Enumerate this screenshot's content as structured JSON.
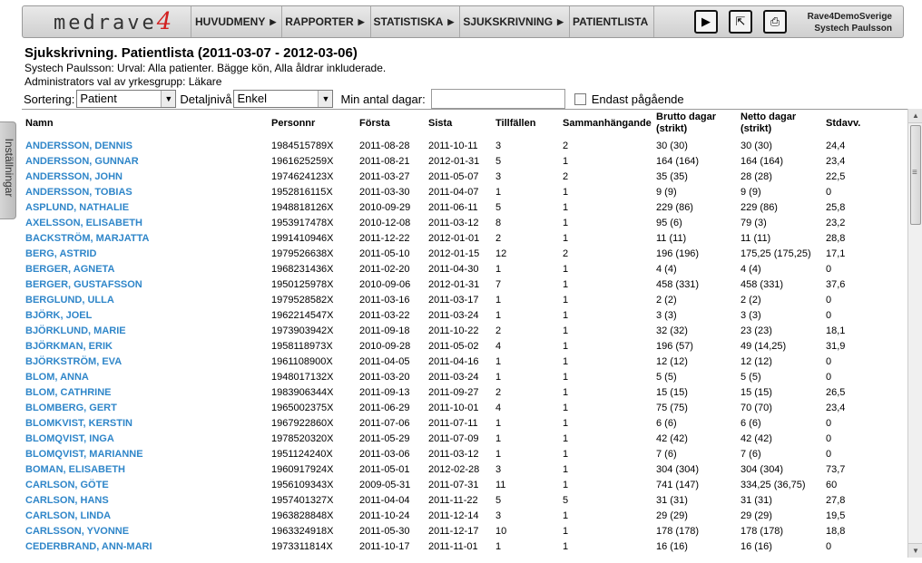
{
  "app": {
    "logo_text": "medrave",
    "logo_number": "4",
    "user_line1": "Rave4DemoSverige",
    "user_line2": "Systech Paulsson"
  },
  "nav": {
    "items": [
      {
        "label": "HUVUDMENY",
        "arrow": "▶"
      },
      {
        "label": "RAPPORTER",
        "arrow": "▶"
      },
      {
        "label": "STATISTISKA",
        "arrow": "▶"
      },
      {
        "label": "SJUKSKRIVNING",
        "arrow": "▶"
      },
      {
        "label": "PATIENTLISTA",
        "arrow": ""
      }
    ]
  },
  "toolbar": {
    "play_icon": "▶",
    "export_icon": "⇱",
    "print_icon": "⎙"
  },
  "side_tab": {
    "label": "Inställningar"
  },
  "page": {
    "title": "Sjukskrivning. Patientlista (2011-03-07 - 2012-03-06)",
    "subtitle": "Systech Paulsson: Urval: Alla patienter. Bägge kön, Alla åldrar inkluderade.",
    "subtitle2": "Administrators val av yrkesgrupp: Läkare"
  },
  "controls": {
    "sort_label": "Sortering:",
    "sort_value": "Patient",
    "detail_label": "Detaljnivå",
    "detail_value": "Enkel",
    "min_days_label": "Min antal dagar:",
    "min_days_value": "",
    "ongoing_label": "Endast pågående",
    "dropdown_glyph": "▼"
  },
  "table": {
    "headers": {
      "name": "Namn",
      "personnr": "Personnr",
      "forsta": "Första",
      "sista": "Sista",
      "tillfallen": "Tillfällen",
      "sammanhangande": "Sammanhängande",
      "brutto": "Brutto dagar\n(strikt)",
      "netto": "Netto dagar\n(strikt)",
      "stdavv": "Stdavv."
    },
    "rows": [
      [
        "ANDERSSON, DENNIS",
        "1984515789X",
        "2011-08-28",
        "2011-10-11",
        "3",
        "2",
        "30 (30)",
        "30 (30)",
        "24,4"
      ],
      [
        "ANDERSSON, GUNNAR",
        "1961625259X",
        "2011-08-21",
        "2012-01-31",
        "5",
        "1",
        "164 (164)",
        "164 (164)",
        "23,4"
      ],
      [
        "ANDERSSON, JOHN",
        "1974624123X",
        "2011-03-27",
        "2011-05-07",
        "3",
        "2",
        "35 (35)",
        "28 (28)",
        "22,5"
      ],
      [
        "ANDERSSON, TOBIAS",
        "1952816115X",
        "2011-03-30",
        "2011-04-07",
        "1",
        "1",
        "9 (9)",
        "9 (9)",
        "0"
      ],
      [
        "ASPLUND, NATHALIE",
        "1948818126X",
        "2010-09-29",
        "2011-06-11",
        "5",
        "1",
        "229 (86)",
        "229 (86)",
        "25,8"
      ],
      [
        "AXELSSON, ELISABETH",
        "1953917478X",
        "2010-12-08",
        "2011-03-12",
        "8",
        "1",
        "95 (6)",
        "79 (3)",
        "23,2"
      ],
      [
        "BACKSTRÖM, MARJATTA",
        "1991410946X",
        "2011-12-22",
        "2012-01-01",
        "2",
        "1",
        "11 (11)",
        "11 (11)",
        "28,8"
      ],
      [
        "BERG, ASTRID",
        "1979526638X",
        "2011-05-10",
        "2012-01-15",
        "12",
        "2",
        "196 (196)",
        "175,25 (175,25)",
        "17,1"
      ],
      [
        "BERGER, AGNETA",
        "1968231436X",
        "2011-02-20",
        "2011-04-30",
        "1",
        "1",
        "4 (4)",
        "4 (4)",
        "0"
      ],
      [
        "BERGER, GUSTAFSSON",
        "1950125978X",
        "2010-09-06",
        "2012-01-31",
        "7",
        "1",
        "458 (331)",
        "458 (331)",
        "37,6"
      ],
      [
        "BERGLUND, ULLA",
        "1979528582X",
        "2011-03-16",
        "2011-03-17",
        "1",
        "1",
        "2 (2)",
        "2 (2)",
        "0"
      ],
      [
        "BJÖRK, JOEL",
        "1962214547X",
        "2011-03-22",
        "2011-03-24",
        "1",
        "1",
        "3 (3)",
        "3 (3)",
        "0"
      ],
      [
        "BJÖRKLUND, MARIE",
        "1973903942X",
        "2011-09-18",
        "2011-10-22",
        "2",
        "1",
        "32 (32)",
        "23 (23)",
        "18,1"
      ],
      [
        "BJÖRKMAN, ERIK",
        "1958118973X",
        "2010-09-28",
        "2011-05-02",
        "4",
        "1",
        "196 (57)",
        "49 (14,25)",
        "31,9"
      ],
      [
        "BJÖRKSTRÖM, EVA",
        "1961108900X",
        "2011-04-05",
        "2011-04-16",
        "1",
        "1",
        "12 (12)",
        "12 (12)",
        "0"
      ],
      [
        "BLOM, ANNA",
        "1948017132X",
        "2011-03-20",
        "2011-03-24",
        "1",
        "1",
        "5 (5)",
        "5 (5)",
        "0"
      ],
      [
        "BLOM, CATHRINE",
        "1983906344X",
        "2011-09-13",
        "2011-09-27",
        "2",
        "1",
        "15 (15)",
        "15 (15)",
        "26,5"
      ],
      [
        "BLOMBERG, GERT",
        "1965002375X",
        "2011-06-29",
        "2011-10-01",
        "4",
        "1",
        "75 (75)",
        "70 (70)",
        "23,4"
      ],
      [
        "BLOMKVIST, KERSTIN",
        "1967922860X",
        "2011-07-06",
        "2011-07-11",
        "1",
        "1",
        "6 (6)",
        "6 (6)",
        "0"
      ],
      [
        "BLOMQVIST, INGA",
        "1978520320X",
        "2011-05-29",
        "2011-07-09",
        "1",
        "1",
        "42 (42)",
        "42 (42)",
        "0"
      ],
      [
        "BLOMQVIST, MARIANNE",
        "1951124240X",
        "2011-03-06",
        "2011-03-12",
        "1",
        "1",
        "7 (6)",
        "7 (6)",
        "0"
      ],
      [
        "BOMAN, ELISABETH",
        "1960917924X",
        "2011-05-01",
        "2012-02-28",
        "3",
        "1",
        "304 (304)",
        "304 (304)",
        "73,7"
      ],
      [
        "CARLSON, GÖTE",
        "1956109343X",
        "2009-05-31",
        "2011-07-31",
        "11",
        "1",
        "741 (147)",
        "334,25 (36,75)",
        "60"
      ],
      [
        "CARLSON, HANS",
        "1957401327X",
        "2011-04-04",
        "2011-11-22",
        "5",
        "5",
        "31 (31)",
        "31 (31)",
        "27,8"
      ],
      [
        "CARLSON, LINDA",
        "1963828848X",
        "2011-10-24",
        "2011-12-14",
        "3",
        "1",
        "29 (29)",
        "29 (29)",
        "19,5"
      ],
      [
        "CARLSSON, YVONNE",
        "1963324918X",
        "2011-05-30",
        "2011-12-17",
        "10",
        "1",
        "178 (178)",
        "178 (178)",
        "18,8"
      ],
      [
        "CEDERBRAND, ANN-MARI",
        "1973311814X",
        "2011-10-17",
        "2011-11-01",
        "1",
        "1",
        "16 (16)",
        "16 (16)",
        "0"
      ]
    ]
  },
  "scrollbar": {
    "up_glyph": "▲",
    "down_glyph": "▼",
    "thumb_glyph": "≡"
  }
}
